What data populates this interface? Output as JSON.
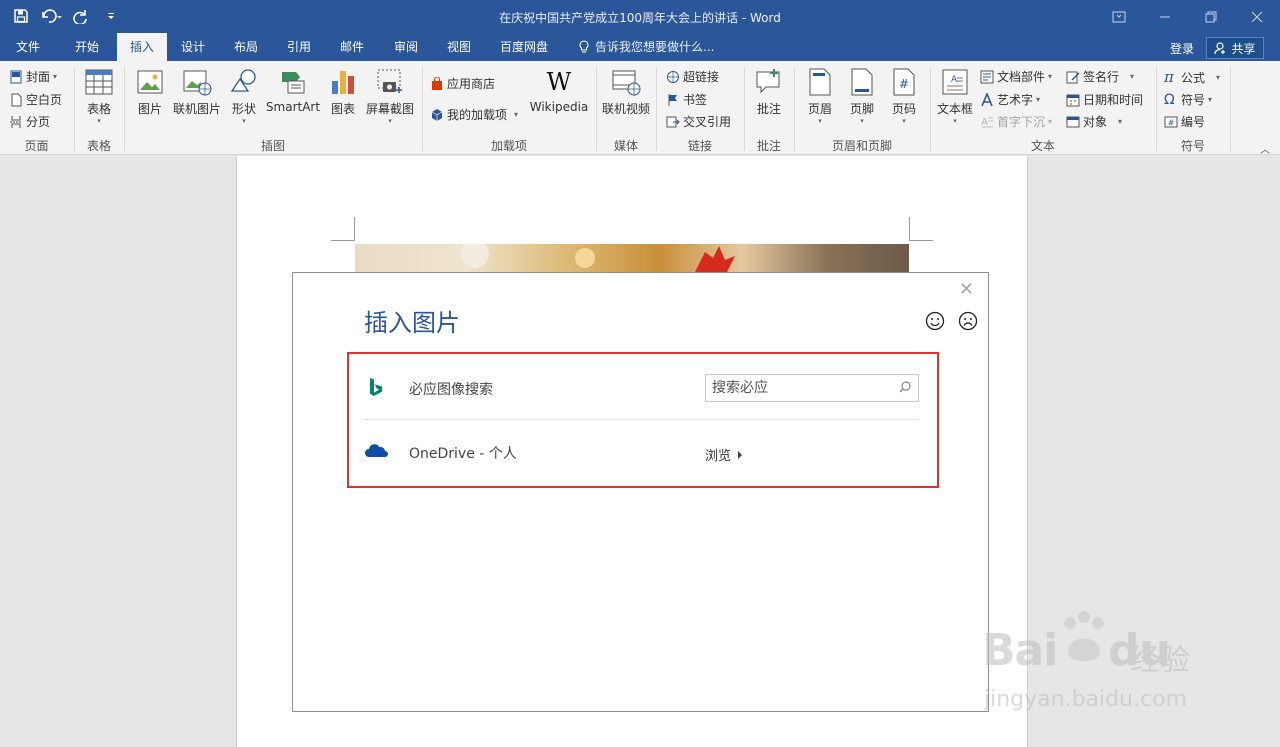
{
  "window": {
    "title": "在庆祝中国共产党成立100周年大会上的讲话 - Word"
  },
  "qat": {
    "save_icon": "save-icon",
    "undo_icon": "undo-icon",
    "redo_icon": "redo-icon",
    "customize_icon": "customize-qat-icon"
  },
  "tabs": [
    {
      "label": "文件"
    },
    {
      "label": "开始"
    },
    {
      "label": "插入",
      "active": true
    },
    {
      "label": "设计"
    },
    {
      "label": "布局"
    },
    {
      "label": "引用"
    },
    {
      "label": "邮件"
    },
    {
      "label": "审阅"
    },
    {
      "label": "视图"
    },
    {
      "label": "百度网盘"
    }
  ],
  "tell_me": "告诉我您想要做什么...",
  "account": {
    "login": "登录",
    "share": "共享"
  },
  "ribbon": {
    "pages": {
      "label": "页面",
      "cover": "封面",
      "blank_page": "空白页",
      "page_break": "分页"
    },
    "tables": {
      "label": "表格",
      "table": "表格"
    },
    "illustrations": {
      "label": "插图",
      "pictures": "图片",
      "online_pictures": "联机图片",
      "shapes": "形状",
      "smartart": "SmartArt",
      "chart": "图表",
      "screenshot": "屏幕截图"
    },
    "addins": {
      "label": "加载项",
      "store": "应用商店",
      "my_addins": "我的加载项",
      "wikipedia": "Wikipedia"
    },
    "media": {
      "label": "媒体",
      "online_video": "联机视频"
    },
    "links": {
      "label": "链接",
      "hyperlink": "超链接",
      "bookmark": "书签",
      "cross_reference": "交叉引用"
    },
    "comments": {
      "label": "批注",
      "comment": "批注"
    },
    "header_footer": {
      "label": "页眉和页脚",
      "header": "页眉",
      "footer": "页脚",
      "page_number": "页码"
    },
    "text": {
      "label": "文本",
      "text_box": "文本框",
      "quick_parts": "文档部件",
      "wordart": "艺术字",
      "drop_cap": "首字下沉",
      "signature_line": "签名行",
      "date_time": "日期和时间",
      "object": "对象"
    },
    "symbols": {
      "label": "符号",
      "equation": "公式",
      "symbol": "符号",
      "number": "编号"
    }
  },
  "dialog": {
    "title": "插入图片",
    "sources": [
      {
        "icon": "bing-icon",
        "label": "必应图像搜索",
        "search_placeholder": "搜索必应"
      },
      {
        "icon": "onedrive-icon",
        "label": "OneDrive - 个人",
        "action": "浏览"
      }
    ]
  },
  "watermark": {
    "brand": "Bai",
    "brand2": "du",
    "cn": "经验",
    "url": "jingyan.baidu.com"
  },
  "colors": {
    "word_blue": "#2b579a",
    "highlight_red": "#e03030",
    "bing_teal": "#008373",
    "onedrive_blue": "#0f4ba8"
  }
}
